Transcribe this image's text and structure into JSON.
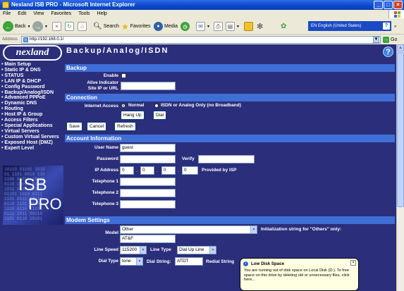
{
  "window": {
    "title": "Nexland ISB PRO - Microsoft Internet Explorer"
  },
  "menu": [
    "File",
    "Edit",
    "View",
    "Favorites",
    "Tools",
    "Help"
  ],
  "toolbar": {
    "back": "Back",
    "search": "Search",
    "favorites": "Favorites",
    "media": "Media",
    "language": "EN English (United States)"
  },
  "address": {
    "label": "Address",
    "url": "http://192.168.0.1/",
    "go": "Go"
  },
  "page": {
    "logo": "nexland",
    "title": "Backup/Analog/ISDN",
    "help": "?",
    "nav": [
      "Main Setup",
      "Static IP & DNS",
      "STATUS",
      "LAN IP & DHCP",
      "Config Password",
      "Backup/Analog/ISDN",
      "Advanced PPPoE",
      "Dynamic DNS",
      "Routing",
      "Host IP & Group",
      "Access Filters",
      "Special Applications",
      "Virtual Servers",
      "Custom Virtual Servers",
      "Exposed Host (DMZ)",
      "Expert Level"
    ],
    "graphic": {
      "line1": "ISB",
      "line2": "PRO"
    }
  },
  "backup": {
    "heading": "Backup",
    "enable_label": "Enable",
    "alive_label_1": "Alive Indicator",
    "alive_label_2": "Site IP or URL",
    "alive_value": ""
  },
  "connection": {
    "heading": "Connection",
    "internet_access_label": "Internet Access",
    "opt_normal": "Normal",
    "opt_isdn": "ISDN or Analog Only (no Broadband)",
    "hangup": "Hang Up",
    "dial": "Dial"
  },
  "actions": {
    "save": "Save",
    "cancel": "Cancel",
    "refresh": "Refresh"
  },
  "account": {
    "heading": "Account Information",
    "username_label": "User Name",
    "username_value": "guest",
    "password_label": "Password",
    "verify_label": "Verify",
    "ip_label": "IP Address",
    "ip": [
      "0",
      "0",
      "0",
      "0"
    ],
    "ip_note": "Provided by ISP",
    "tel1_label": "Telephone 1",
    "tel2_label": "Telephone 2",
    "tel3_label": "Telephone 3"
  },
  "modem": {
    "heading": "Modem Settings",
    "model_label": "Model",
    "model_value": "Other",
    "model_text": "AT&F",
    "init_note": "Initialization string for \"Others\" only:",
    "linespeed_label": "Line Speed",
    "linespeed_value": "115200",
    "linetype_label": "Line Type",
    "linetype_value": "Dial Up Line",
    "dialtype_label": "Dial Type",
    "dialtype_value": "tone",
    "dialstring_label": "Dial String:",
    "dialstring_value": "ATDT",
    "redial_label": "Redial String"
  },
  "balloon": {
    "title": "Low Disk Space",
    "message": "You are running out of disk space on Local Disk (D:). To free space on this drive by deleting old or unnecessary files, click here..."
  },
  "colors": {
    "page_bg": "#2B2E7B",
    "section_bar": "#3F6ED7",
    "xp_blue": "#0A47C9"
  }
}
